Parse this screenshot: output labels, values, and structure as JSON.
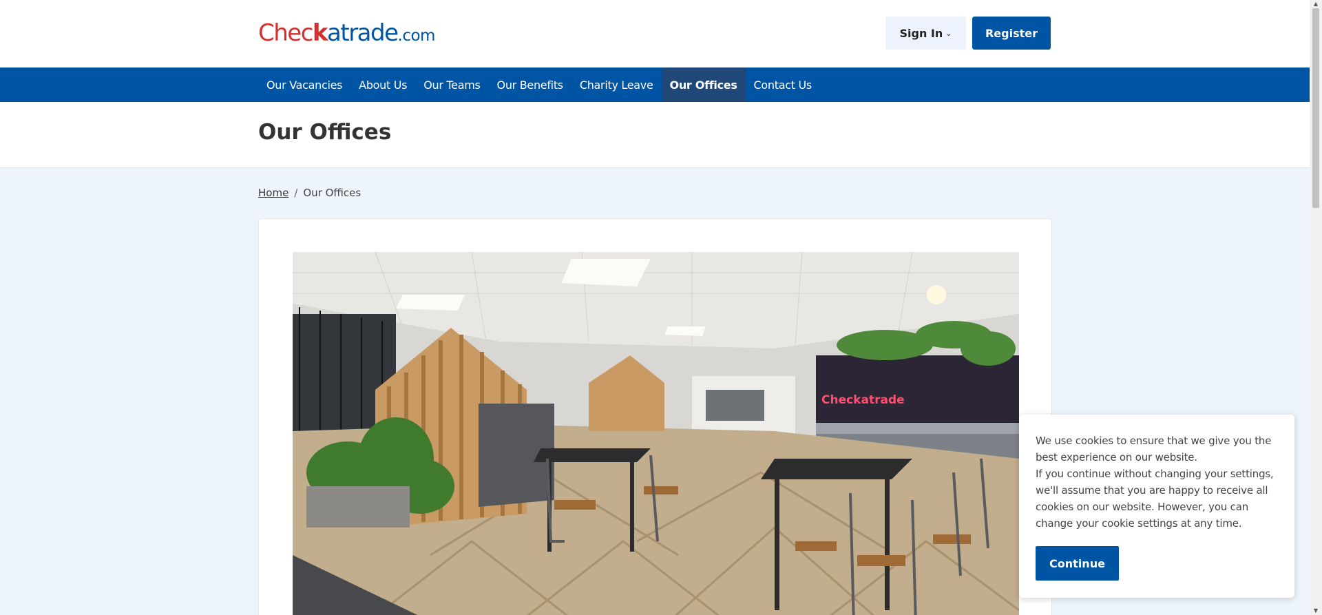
{
  "header": {
    "logo": {
      "part1": "Chec",
      "part2": "k",
      "part3": "atrade",
      "part4": ".com"
    },
    "sign_in_label": "Sign In",
    "register_label": "Register"
  },
  "nav": {
    "items": [
      {
        "label": "Our Vacancies"
      },
      {
        "label": "About Us"
      },
      {
        "label": "Our Teams"
      },
      {
        "label": "Our Benefits"
      },
      {
        "label": "Charity Leave"
      },
      {
        "label": "Our Offices",
        "active": true
      },
      {
        "label": "Contact Us"
      }
    ]
  },
  "page": {
    "title": "Our Offices"
  },
  "breadcrumb": {
    "home": "Home",
    "separator": "/",
    "current": "Our Offices"
  },
  "photo": {
    "neon_sign": "Checkatrade"
  },
  "cookie": {
    "line1": "We use cookies to ensure that we give you the best experience on our website.",
    "line2": "If you continue without changing your settings, we'll assume that you are happy to receive all cookies on our website. However, you can change your cookie settings at any time.",
    "continue_label": "Continue"
  },
  "colors": {
    "brand_blue": "#0054a4",
    "brand_red": "#d32f2f",
    "active_nav": "#1f4778",
    "page_bg": "#eef4fc"
  }
}
